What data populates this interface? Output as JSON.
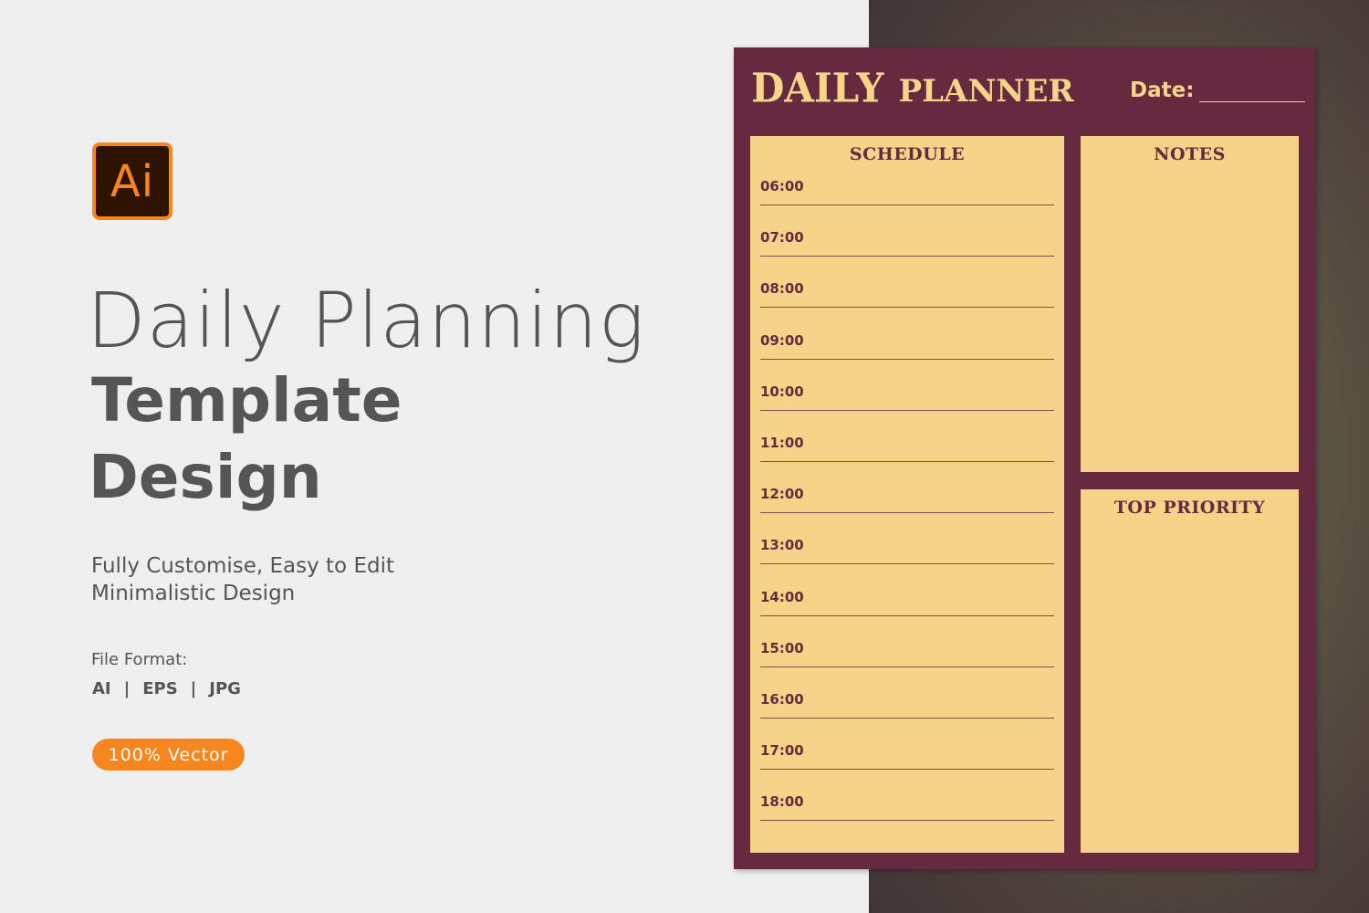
{
  "logo": {
    "text": "Ai",
    "icon": "adobe-illustrator-icon",
    "colors": {
      "border": "#f7861f",
      "background": "#2e1300"
    }
  },
  "heading": {
    "line1": "Daily Planning",
    "line2": "Template",
    "line3": "Design"
  },
  "subtitle": {
    "line1": "Fully Customise, Easy to Edit",
    "line2": "Minimalistic Design"
  },
  "file_format": {
    "label": "File Format:",
    "formats": [
      "AI",
      "EPS",
      "JPG"
    ],
    "separator": "|"
  },
  "badge": {
    "label": "100% Vector",
    "color": "#f7861f"
  },
  "planner": {
    "title_main": "DAILY",
    "title_sub": "PLANNER",
    "date_label": "Date:",
    "colors": {
      "frame": "#662a40",
      "panel": "#f5d388"
    },
    "schedule": {
      "heading": "SCHEDULE",
      "times": [
        "06:00",
        "07:00",
        "08:00",
        "09:00",
        "10:00",
        "11:00",
        "12:00",
        "13:00",
        "14:00",
        "15:00",
        "16:00",
        "17:00",
        "18:00"
      ]
    },
    "notes": {
      "heading": "NOTES"
    },
    "top_priority": {
      "heading": "TOP PRIORITY"
    }
  }
}
